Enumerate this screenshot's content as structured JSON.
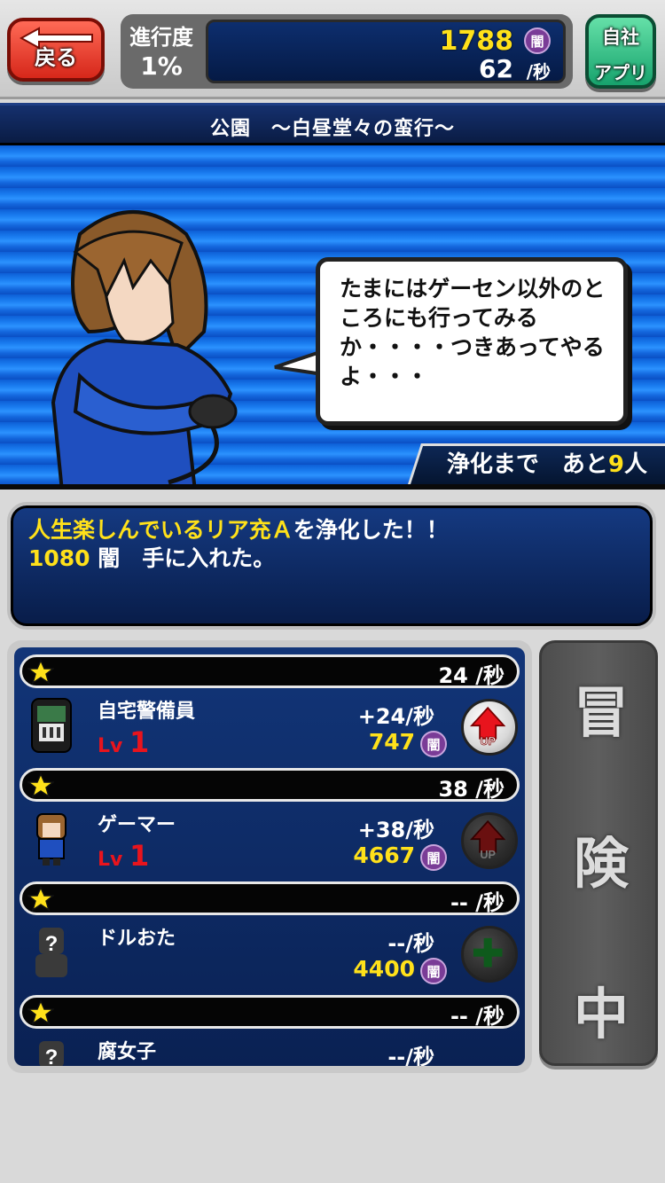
{
  "header": {
    "back_label": "戻る",
    "progress_label": "進行度",
    "progress_value": "1%",
    "currency_total": "1788",
    "currency_unit_icon": "闇",
    "currency_rate": "62",
    "currency_rate_unit": "/秒",
    "app_label_1": "自社",
    "app_label_2": "アプリ"
  },
  "stage": {
    "title": "公園　～白昼堂々の蛮行～"
  },
  "scene": {
    "speech": "たまにはゲーセン以外のところにも行ってみるか・・・・つきあってやるよ・・・",
    "purify_prefix": "浄化まで　あと",
    "purify_count": "9",
    "purify_suffix": "人"
  },
  "message": {
    "line1_highlight": "人生楽しんでいるリア充Ａ",
    "line1_rest": "を浄化した！！",
    "line2_amount": "1080",
    "line2_rest": " 闇　手に入れた。"
  },
  "units": [
    {
      "rate": "24 /秒",
      "name": "自宅警備員",
      "lv_prefix": "Lv",
      "lv": "1",
      "plus": "+24/秒",
      "cost": "747",
      "cost_icon": "闇",
      "button": "UP",
      "button_state": "active"
    },
    {
      "rate": "38 /秒",
      "name": "ゲーマー",
      "lv_prefix": "Lv",
      "lv": "1",
      "plus": "+38/秒",
      "cost": "4667",
      "cost_icon": "闇",
      "button": "UP",
      "button_state": "inactive"
    },
    {
      "rate": "-- /秒",
      "name": "ドルおた",
      "lv_prefix": "",
      "lv": "",
      "plus": "--/秒",
      "cost": "4400",
      "cost_icon": "闇",
      "button": "add",
      "button_state": "inactive"
    },
    {
      "rate": "-- /秒",
      "name": "腐女子",
      "lv_prefix": "",
      "lv": "",
      "plus": "--/秒",
      "cost": "",
      "cost_icon": "",
      "button": "",
      "button_state": ""
    }
  ],
  "side": {
    "chars": [
      "冒",
      "険",
      "中"
    ]
  },
  "colors": {
    "accent_yellow": "#ffe11a",
    "level_red": "#e8141d",
    "panel_blue": "#0a2153",
    "yami_purple": "#7a3c97"
  }
}
